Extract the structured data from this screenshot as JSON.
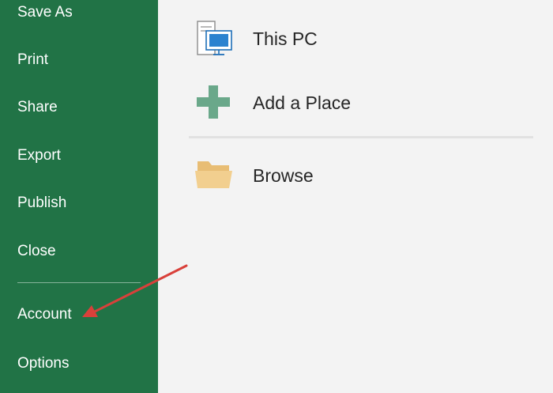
{
  "sidebar": {
    "background": "#217346",
    "items": [
      {
        "label": "Save As"
      },
      {
        "label": "Print"
      },
      {
        "label": "Share"
      },
      {
        "label": "Export"
      },
      {
        "label": "Publish"
      },
      {
        "label": "Close"
      },
      {
        "label": "Account"
      },
      {
        "label": "Options"
      }
    ]
  },
  "main": {
    "places": [
      {
        "label": "This PC",
        "icon": "this-pc-icon"
      },
      {
        "label": "Add a Place",
        "icon": "plus-icon"
      },
      {
        "label": "Browse",
        "icon": "folder-icon"
      }
    ]
  },
  "colors": {
    "accent": "#217346",
    "arrow": "#d9403a",
    "folder": "#e8bd74"
  }
}
